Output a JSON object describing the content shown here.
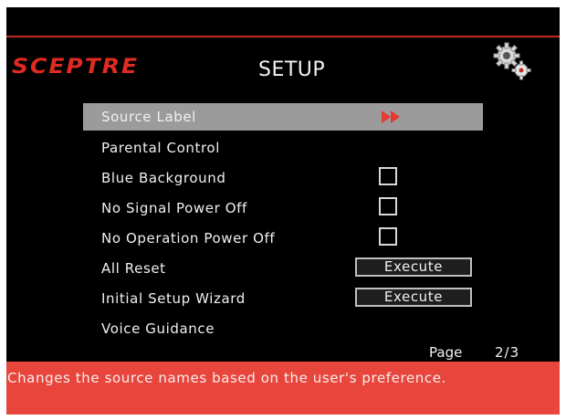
{
  "header": {
    "brand": "SCEPTRE",
    "title": "SETUP",
    "settings_icon": "gears-icon",
    "accent_color": "#e02a22"
  },
  "menu": {
    "items": [
      {
        "label": "Source Label",
        "control": "arrows-icon",
        "selected": true
      },
      {
        "label": "Parental Control",
        "control": "none"
      },
      {
        "label": "Blue Background",
        "control": "checkbox",
        "checked": false
      },
      {
        "label": "No Signal Power Off",
        "control": "checkbox",
        "checked": false
      },
      {
        "label": "No Operation Power Off",
        "control": "checkbox",
        "checked": false
      },
      {
        "label": "All Reset",
        "control": "button",
        "button_label": "Execute"
      },
      {
        "label": "Initial Setup Wizard",
        "control": "button",
        "button_label": "Execute"
      },
      {
        "label": "Voice Guidance",
        "control": "none"
      }
    ],
    "selected_color": "#9b9b9b"
  },
  "pagination": {
    "label": "Page",
    "value": "2/3"
  },
  "help": {
    "text": "Changes the source names based on the user's preference.",
    "bar_color": "#e8463c"
  }
}
